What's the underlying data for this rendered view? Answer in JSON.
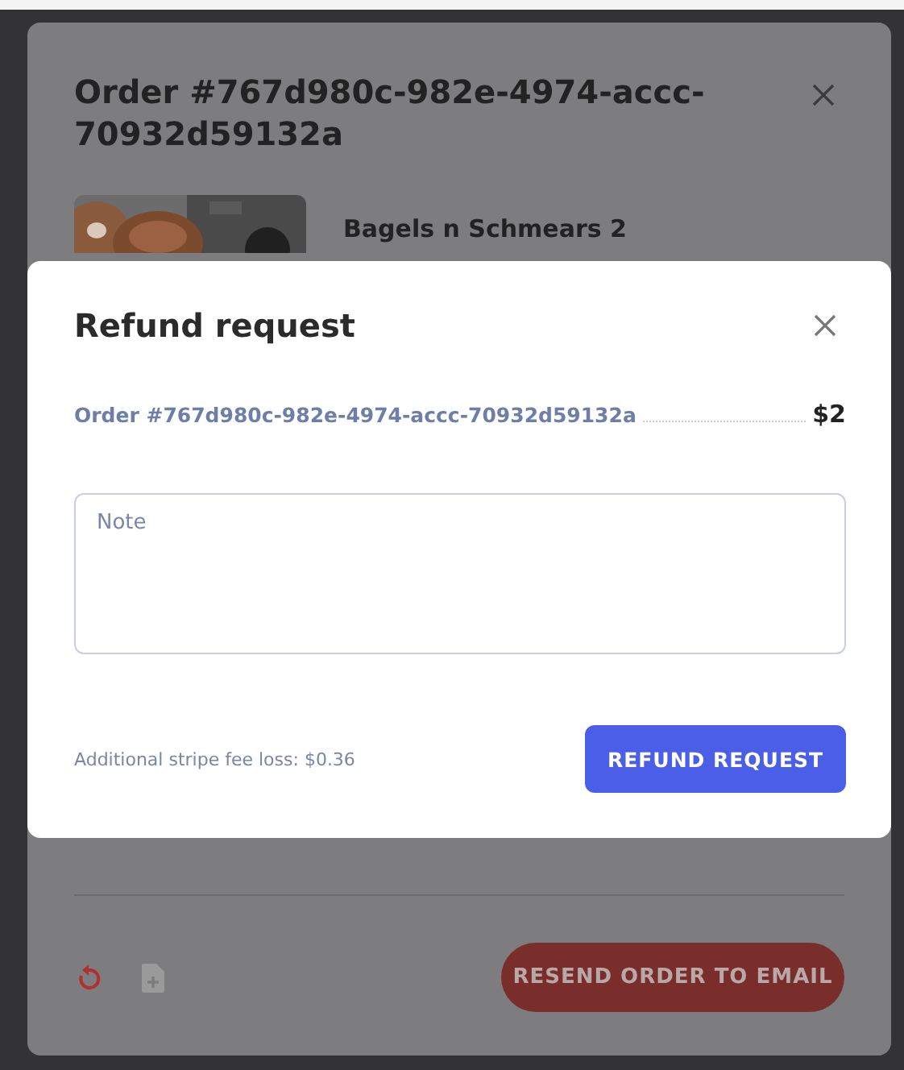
{
  "background_order": {
    "title": "Order #767d980c-982e-4974-accc-70932d59132a",
    "item": {
      "kind": "picture",
      "name": "Bagels n Schmears 2"
    },
    "resend_button": "RESEND ORDER TO EMAIL"
  },
  "refund_dialog": {
    "title": "Refund request",
    "order": {
      "label": "Order #767d980c-982e-4974-accc-70932d59132a",
      "amount": "$2"
    },
    "note": {
      "placeholder": "Note"
    },
    "fee_note": "Additional stripe fee loss: $0.36",
    "submit_button": "REFUND REQUEST"
  }
}
